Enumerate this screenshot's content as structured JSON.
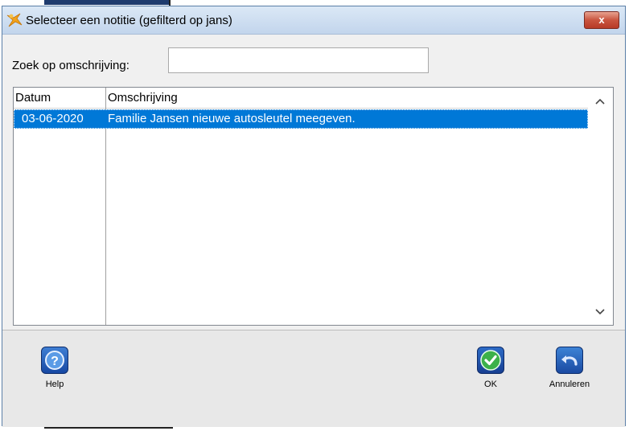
{
  "window": {
    "title": "Selecteer een notitie (gefilterd op jans)",
    "close_label": "x"
  },
  "search": {
    "label": "Zoek op omschrijving:",
    "value": "",
    "placeholder": ""
  },
  "table": {
    "columns": [
      "Datum",
      "Omschrijving"
    ],
    "rows": [
      {
        "datum": "03-06-2020",
        "omschrijving": "Familie Jansen nieuwe autosleutel meegeven."
      }
    ],
    "selected_row": 0
  },
  "toolbar": {
    "help_label": "Help",
    "ok_label": "OK",
    "cancel_label": "Annuleren"
  },
  "colors": {
    "selection": "#0078d7",
    "titlebar": "#c2d5ec",
    "close": "#c9543f"
  },
  "icons": {
    "title": "app-pointer-icon",
    "help": "question-mark-icon",
    "ok": "checkmark-icon",
    "cancel": "undo-arrow-icon",
    "scroll_up": "chevron-up-icon",
    "scroll_down": "chevron-down-icon"
  }
}
